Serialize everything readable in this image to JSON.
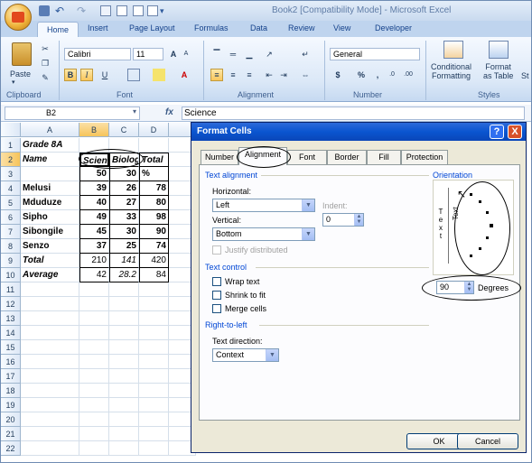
{
  "window": {
    "title": "Book2  [Compatibility Mode] - Microsoft Excel"
  },
  "ribbon": {
    "tabs": [
      "Home",
      "Insert",
      "Page Layout",
      "Formulas",
      "Data",
      "Review",
      "View",
      "Developer"
    ],
    "groups": [
      "Clipboard",
      "Font",
      "Alignment",
      "Number",
      "Styles"
    ],
    "paste_label": "Paste",
    "font_name": "Calibri",
    "font_size": "11",
    "number_format": "General",
    "conditional_formatting_label": "Conditional\nFormatting",
    "format_as_table_label": "Format\nas Table",
    "cell_styles_label": "St",
    "bold_btn": "B",
    "italic_btn": "I",
    "underline_btn": "U",
    "currency_btn": "$",
    "percent_btn": "%",
    "comma_btn": ","
  },
  "formula_bar": {
    "name_box": "B2",
    "fx": "fx",
    "content": "Science"
  },
  "sheet": {
    "columns": [
      "A",
      "B",
      "C",
      "D"
    ],
    "selected_column": "B",
    "selected_row": "2",
    "rows": [
      {
        "n": "1",
        "a": "Grade 8A",
        "b": "",
        "c": "",
        "d": ""
      },
      {
        "n": "2",
        "a": "Name",
        "b": "Scienc",
        "c": "Biolog",
        "d": "Total"
      },
      {
        "n": "3",
        "a": "",
        "b": "50",
        "c": "30",
        "d": "%"
      },
      {
        "n": "4",
        "a": "Melusi",
        "b": "39",
        "c": "26",
        "d": "78"
      },
      {
        "n": "5",
        "a": "Mduduze",
        "b": "40",
        "c": "27",
        "d": "80"
      },
      {
        "n": "6",
        "a": "Sipho",
        "b": "49",
        "c": "33",
        "d": "98"
      },
      {
        "n": "7",
        "a": "Sibongile",
        "b": "45",
        "c": "30",
        "d": "90"
      },
      {
        "n": "8",
        "a": "Senzo",
        "b": "37",
        "c": "25",
        "d": "74"
      },
      {
        "n": "9",
        "a": "Total",
        "b": "210",
        "c": "141",
        "d": "420"
      },
      {
        "n": "10",
        "a": "Average",
        "b": "42",
        "c": "28.2",
        "d": "84"
      },
      {
        "n": "11",
        "a": "",
        "b": "",
        "c": "",
        "d": ""
      },
      {
        "n": "12",
        "a": "",
        "b": "",
        "c": "",
        "d": ""
      },
      {
        "n": "13",
        "a": "",
        "b": "",
        "c": "",
        "d": ""
      },
      {
        "n": "14",
        "a": "",
        "b": "",
        "c": "",
        "d": ""
      },
      {
        "n": "15",
        "a": "",
        "b": "",
        "c": "",
        "d": ""
      },
      {
        "n": "16",
        "a": "",
        "b": "",
        "c": "",
        "d": ""
      },
      {
        "n": "17",
        "a": "",
        "b": "",
        "c": "",
        "d": ""
      },
      {
        "n": "18",
        "a": "",
        "b": "",
        "c": "",
        "d": ""
      },
      {
        "n": "19",
        "a": "",
        "b": "",
        "c": "",
        "d": ""
      },
      {
        "n": "20",
        "a": "",
        "b": "",
        "c": "",
        "d": ""
      },
      {
        "n": "21",
        "a": "",
        "b": "",
        "c": "",
        "d": ""
      },
      {
        "n": "22",
        "a": "",
        "b": "",
        "c": "",
        "d": ""
      }
    ]
  },
  "dialog": {
    "title": "Format Cells",
    "help": "?",
    "close": "X",
    "tabs": [
      "Number",
      "Alignment",
      "Font",
      "Border",
      "Fill",
      "Protection"
    ],
    "active_tab": "Alignment",
    "text_alignment_label": "Text alignment",
    "horizontal_label": "Horizontal:",
    "horizontal_value": "Left",
    "indent_label": "Indent:",
    "indent_value": "0",
    "vertical_label": "Vertical:",
    "vertical_value": "Bottom",
    "justify_distributed_label": "Justify distributed",
    "text_control_label": "Text control",
    "wrap_text_label": "Wrap text",
    "shrink_to_fit_label": "Shrink to fit",
    "merge_cells_label": "Merge cells",
    "rtl_label": "Right-to-left",
    "text_direction_label": "Text direction:",
    "text_direction_value": "Context",
    "orientation_label": "Orientation",
    "vertical_text_letters": [
      "T",
      "e",
      "x",
      "t"
    ],
    "rotated_text": "Text",
    "degrees_value": "90",
    "degrees_label": "Degrees",
    "ok_label": "OK",
    "cancel_label": "Cancel"
  }
}
